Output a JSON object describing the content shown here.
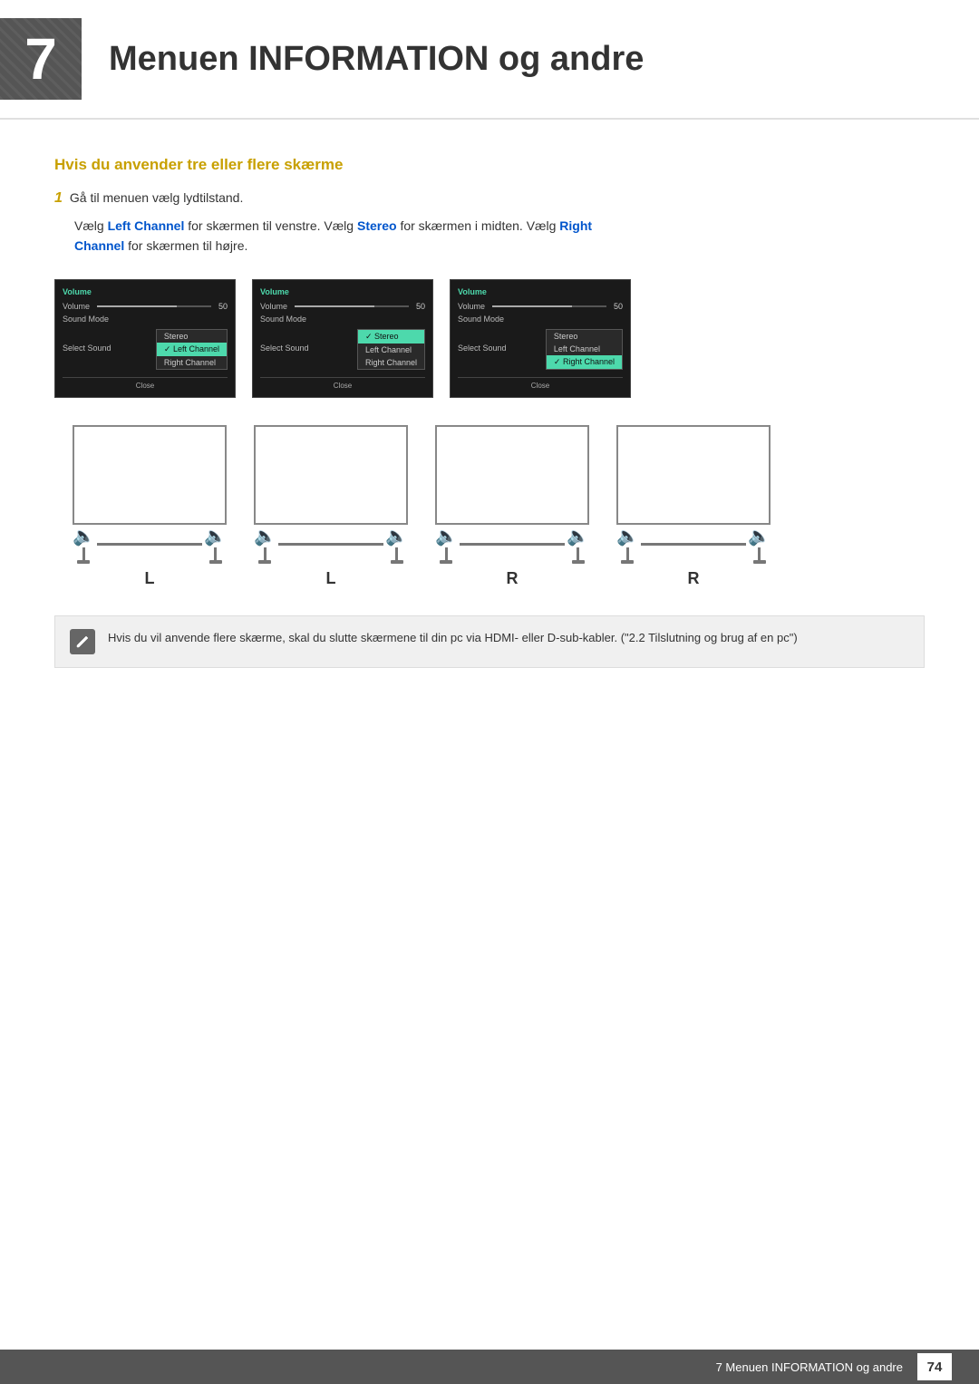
{
  "header": {
    "chapter_num": "7",
    "chapter_title": "Menuen INFORMATION og andre"
  },
  "section": {
    "heading": "Hvis du anvender tre eller flere skærme",
    "step1_label": "1",
    "step1_text": "Gå til menuen vælg lydtilstand.",
    "step1_desc_parts": [
      "Vælg ",
      "Left Channel",
      " for skærmen til venstre. Vælg ",
      "Stereo",
      " for skærmen i midten. Vælg ",
      "Right Channel",
      " for skærmen til højre."
    ]
  },
  "osd_panels": [
    {
      "id": "panel1",
      "section_title": "Volume",
      "volume_label": "Volume",
      "volume_value": "50",
      "sound_mode_label": "Sound Mode",
      "select_sound_label": "Select Sound",
      "dropdown_items": [
        "Stereo",
        "Left Channel",
        "Right Channel"
      ],
      "selected_item": "Left Channel",
      "close_label": "Close"
    },
    {
      "id": "panel2",
      "section_title": "Volume",
      "volume_label": "Volume",
      "volume_value": "50",
      "sound_mode_label": "Sound Mode",
      "select_sound_label": "Select Sound",
      "dropdown_items": [
        "Stereo",
        "Left Channel",
        "Right Channel"
      ],
      "selected_item": "Stereo",
      "close_label": "Close"
    },
    {
      "id": "panel3",
      "section_title": "Volume",
      "volume_label": "Volume",
      "volume_value": "50",
      "sound_mode_label": "Sound Mode",
      "select_sound_label": "Select Sound",
      "dropdown_items": [
        "Stereo",
        "Left Channel",
        "Right Channel"
      ],
      "selected_item": "Right Channel",
      "close_label": "Close"
    }
  ],
  "diagram_labels": [
    "L",
    "L",
    "R",
    "R"
  ],
  "note": {
    "text": "Hvis du vil anvende flere skærme, skal du slutte skærmene til din pc via HDMI- eller D-sub-kabler. (\"2.2 Tilslutning og brug af en pc\")"
  },
  "footer": {
    "text": "7 Menuen INFORMATION og andre",
    "page": "74"
  }
}
